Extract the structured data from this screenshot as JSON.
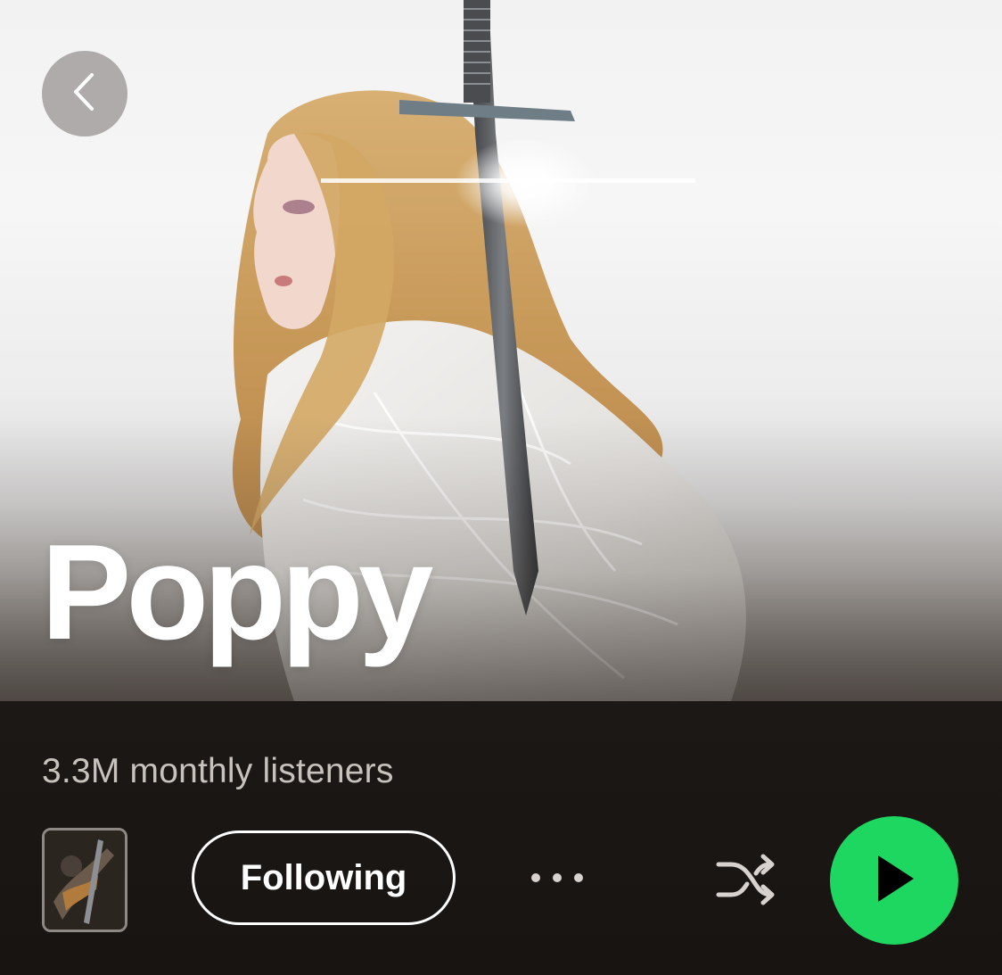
{
  "artist": {
    "name": "Poppy",
    "monthly_listeners": "3.3M monthly listeners"
  },
  "actions": {
    "follow_label": "Following"
  },
  "icons": {
    "back": "chevron-left-icon",
    "more": "more-horizontal-icon",
    "shuffle": "shuffle-icon",
    "play": "play-icon"
  },
  "colors": {
    "accent": "#1ed760",
    "background": "#221d1a",
    "secondary_text": "#c8c2bd",
    "primary_text": "#ffffff"
  }
}
